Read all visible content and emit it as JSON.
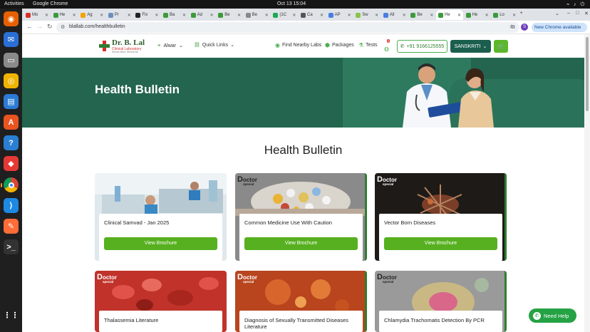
{
  "os": {
    "activities": "Activities",
    "app_name": "Google Chrome",
    "clock": "Oct 13  15:04"
  },
  "dock": [
    {
      "name": "firefox",
      "color": "#e66000",
      "glyph": "◉"
    },
    {
      "name": "thunderbird",
      "color": "#2a6fd6",
      "glyph": "✉"
    },
    {
      "name": "files",
      "color": "#8a8a8a",
      "glyph": "▭"
    },
    {
      "name": "rhythmbox",
      "color": "#f0b400",
      "glyph": "◎"
    },
    {
      "name": "libreoffice-writer",
      "color": "#2b7bd6",
      "glyph": "▤"
    },
    {
      "name": "app-center",
      "color": "#e95420",
      "glyph": "A"
    },
    {
      "name": "help",
      "color": "#2a7fd4",
      "glyph": "?"
    },
    {
      "name": "anydesk",
      "color": "#e53935",
      "glyph": "◆"
    },
    {
      "name": "chrome",
      "color": "#ffffff",
      "glyph": "●"
    },
    {
      "name": "vscode",
      "color": "#1e88e5",
      "glyph": "⟩"
    },
    {
      "name": "postman",
      "color": "#ff6c37",
      "glyph": "✎"
    },
    {
      "name": "terminal",
      "color": "#333333",
      "glyph": ">_"
    },
    {
      "name": "app-grid",
      "color": "#1f1f1f",
      "glyph": "⋮⋮"
    }
  ],
  "browser": {
    "tabs": [
      {
        "label": "Mo",
        "color": "#d93025"
      },
      {
        "label": "He",
        "color": "#3c9a3c"
      },
      {
        "label": "Ag",
        "color": "#f4a300"
      },
      {
        "label": "Pr",
        "color": "#6c8ebf"
      },
      {
        "label": "Fix",
        "color": "#222222"
      },
      {
        "label": "Ba",
        "color": "#3c9a3c"
      },
      {
        "label": "Ad",
        "color": "#3c9a3c"
      },
      {
        "label": "Be",
        "color": "#3c9a3c"
      },
      {
        "label": "Be",
        "color": "#888888"
      },
      {
        "label": "(1C",
        "color": "#1da851"
      },
      {
        "label": "Ca",
        "color": "#555555"
      },
      {
        "label": "AP",
        "color": "#4a7de2"
      },
      {
        "label": "Sw",
        "color": "#8bc34a"
      },
      {
        "label": "All",
        "color": "#4a7de2"
      },
      {
        "label": "Be",
        "color": "#3c9a3c"
      },
      {
        "label": "He",
        "color": "#3c9a3c",
        "active": true
      },
      {
        "label": "He",
        "color": "#3c9a3c"
      },
      {
        "label": "Lo",
        "color": "#3c9a3c"
      }
    ],
    "url": "lalpathlabs.com/healthbulletin",
    "url_display": "blallab.com/healthbulletin",
    "profile_initial": "S",
    "new_chrome": "New Chrome available"
  },
  "header": {
    "logo_name": "Dr. B. Lal",
    "logo_sub": "Clinical Laboratory",
    "logo_tag": "Serves Best, Serves All",
    "location": "Alwar",
    "quick_links": "Quick Links",
    "nearby_labs": "Find Nearby Labs",
    "packages": "Packages",
    "tests": "Tests",
    "cart_count": "0",
    "phone": "+91 9166125555",
    "user": "SANSKRITI"
  },
  "hero": {
    "title": "Health Bulletin"
  },
  "main": {
    "title": "Health Bulletin",
    "doctor_tag": "octor",
    "doctor_tag_sub": "special",
    "cards": [
      {
        "title": "Clinical Samvad - Jan 2025",
        "button": "View Brochure"
      },
      {
        "title": "Common Medicine Use With Caution",
        "button": "View Brochure"
      },
      {
        "title": "Vector Born Diseases",
        "button": "View Brochure"
      },
      {
        "title": "Thalassemia Literature",
        "button": ""
      },
      {
        "title": "Diagnosis of Sexually Transmitted Diseases Literature",
        "button": ""
      },
      {
        "title": "Chlamydia Trachomatis Detection By PCR",
        "button": ""
      }
    ]
  },
  "help": {
    "label": "Need Help"
  }
}
